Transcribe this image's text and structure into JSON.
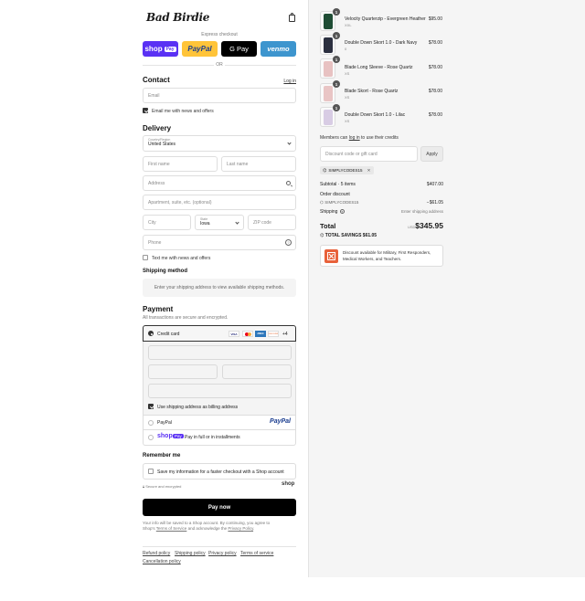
{
  "brand": {
    "logo_text": "Bad Birdie"
  },
  "express": {
    "label": "Express checkout",
    "shoppay": "shop",
    "shoppay_badge": "Pay",
    "paypal": "PayPal",
    "gpay": "G Pay",
    "venmo": "venmo",
    "or": "OR"
  },
  "contact": {
    "title": "Contact",
    "login": "Log in",
    "email_placeholder": "Email",
    "news_label": "Email me with news and offers"
  },
  "delivery": {
    "title": "Delivery",
    "country_label": "Country/Region",
    "country_value": "United States",
    "first_name": "First name",
    "last_name": "Last name",
    "address": "Address",
    "apartment": "Apartment, suite, etc. (optional)",
    "city": "City",
    "state_label": "State",
    "state_value": "Iowa",
    "zip": "ZIP code",
    "phone": "Phone",
    "text_label": "Text me with news and offers"
  },
  "shipping": {
    "title": "Shipping method",
    "info": "Enter your shipping address to view available shipping methods."
  },
  "payment": {
    "title": "Payment",
    "subtitle": "All transactions are secure and encrypted.",
    "credit_card": "Credit card",
    "more_cards": "+4",
    "card_visa": "VISA",
    "card_amex": "AMEX",
    "card_discover": "DISCOVER",
    "billing_label": "Use shipping address as billing address",
    "paypal": "PayPal",
    "paypal_logo": "PayPal",
    "shop_logo": "shop",
    "shop_badge": "Pay",
    "shop_label": "Pay in full or in installments"
  },
  "remember": {
    "title": "Remember me",
    "label": "Save my information for a faster checkout with a Shop account",
    "secure": "Secure and encrypted",
    "shop": "shop"
  },
  "pay_now": "Pay now",
  "legal": {
    "line1": "Your info will be saved to a Shop account. By continuing, you agree to",
    "line2_pre": "Shop's",
    "terms": "Terms of Service",
    "line2_mid": "and acknowledge the",
    "privacy": "Privacy Policy",
    "line2_end": "."
  },
  "footer": {
    "refund": "Refund policy",
    "shipping": "Shipping policy",
    "privacy": "Privacy policy",
    "terms": "Terms of service",
    "cancellation": "Cancellation policy"
  },
  "cart": {
    "items": [
      {
        "name": "Velocity Quarterzip - Evergreen Heather",
        "variant": "XXL",
        "price": "$95.00",
        "qty": "1",
        "color": "#1f4d35"
      },
      {
        "name": "Double Down Skort 1.0 - Dark Navy",
        "variant": "0",
        "price": "$78.00",
        "qty": "1",
        "color": "#2b2f3f"
      },
      {
        "name": "Blade Long Sleeve - Rose Quartz",
        "variant": "XS",
        "price": "$78.00",
        "qty": "1",
        "color": "#e8c2c2"
      },
      {
        "name": "Blade Skort - Rose Quartz",
        "variant": "XS",
        "price": "$78.00",
        "qty": "1",
        "color": "#e9c5c5"
      },
      {
        "name": "Double Down Skort 1.0 - Lilac",
        "variant": "XS",
        "price": "$78.00",
        "qty": "1",
        "color": "#d8cce4"
      }
    ],
    "members": {
      "pre": "Members can",
      "link": "log in",
      "post": "to use their credits"
    },
    "discount_placeholder": "Discount code or gift card",
    "apply": "Apply",
    "code_tag": "SIMPLYCODES15",
    "subtotal_label": "Subtotal · 5 items",
    "subtotal_value": "$407.00",
    "order_discount_label": "Order discount",
    "discount_code": "SIMPLYCODES15",
    "discount_value": "−$61.05",
    "shipping_label": "Shipping",
    "shipping_value": "Enter shipping address",
    "total_label": "Total",
    "currency": "USD",
    "total_value": "$345.95",
    "savings_label": "TOTAL SAVINGS",
    "savings_value": "$61.05",
    "promo_text": "Discount available for Military, First Responders, Medical Workers, and Teachers."
  },
  "colors": {
    "shop": "#5a31f4",
    "paypal": "#ffc439",
    "venmo": "#3d95ce",
    "promo": "#e8613a"
  }
}
